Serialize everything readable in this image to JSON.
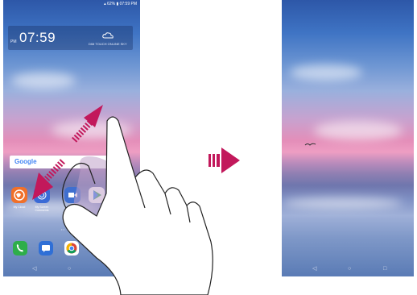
{
  "left_phone": {
    "status_text": "▴ 62% ▮ 07:59 PM",
    "clock": {
      "ampm": "PM",
      "time": "07:59",
      "weather_text": "DIM TOUCH ONLINE SKY"
    },
    "search": {
      "logo": "Google"
    },
    "apps": [
      {
        "label": "My Cloud",
        "icon": "globe-icon",
        "color": "#f0702a"
      },
      {
        "label": "My Screen Comments",
        "icon": "fingerprint-icon",
        "color": "#3a6ad6"
      },
      {
        "label": "",
        "icon": "video-icon",
        "color": "#3f6fcf"
      },
      {
        "label": "",
        "icon": "play-store-icon",
        "color": "#ffffff"
      }
    ],
    "dock": [
      {
        "icon": "phone-icon",
        "color": "#2eae4a"
      },
      {
        "icon": "messages-icon",
        "color": "#2f6fd6"
      },
      {
        "icon": "chrome-icon",
        "color": "#ffffff"
      }
    ],
    "nav": [
      "◁",
      "○"
    ]
  },
  "right_phone": {
    "nav": [
      "◁",
      "○",
      "□"
    ]
  },
  "colors": {
    "arrow_accent": "#c2185b",
    "hand_outline": "#222222",
    "hand_shadow": "#bfa0c8"
  }
}
